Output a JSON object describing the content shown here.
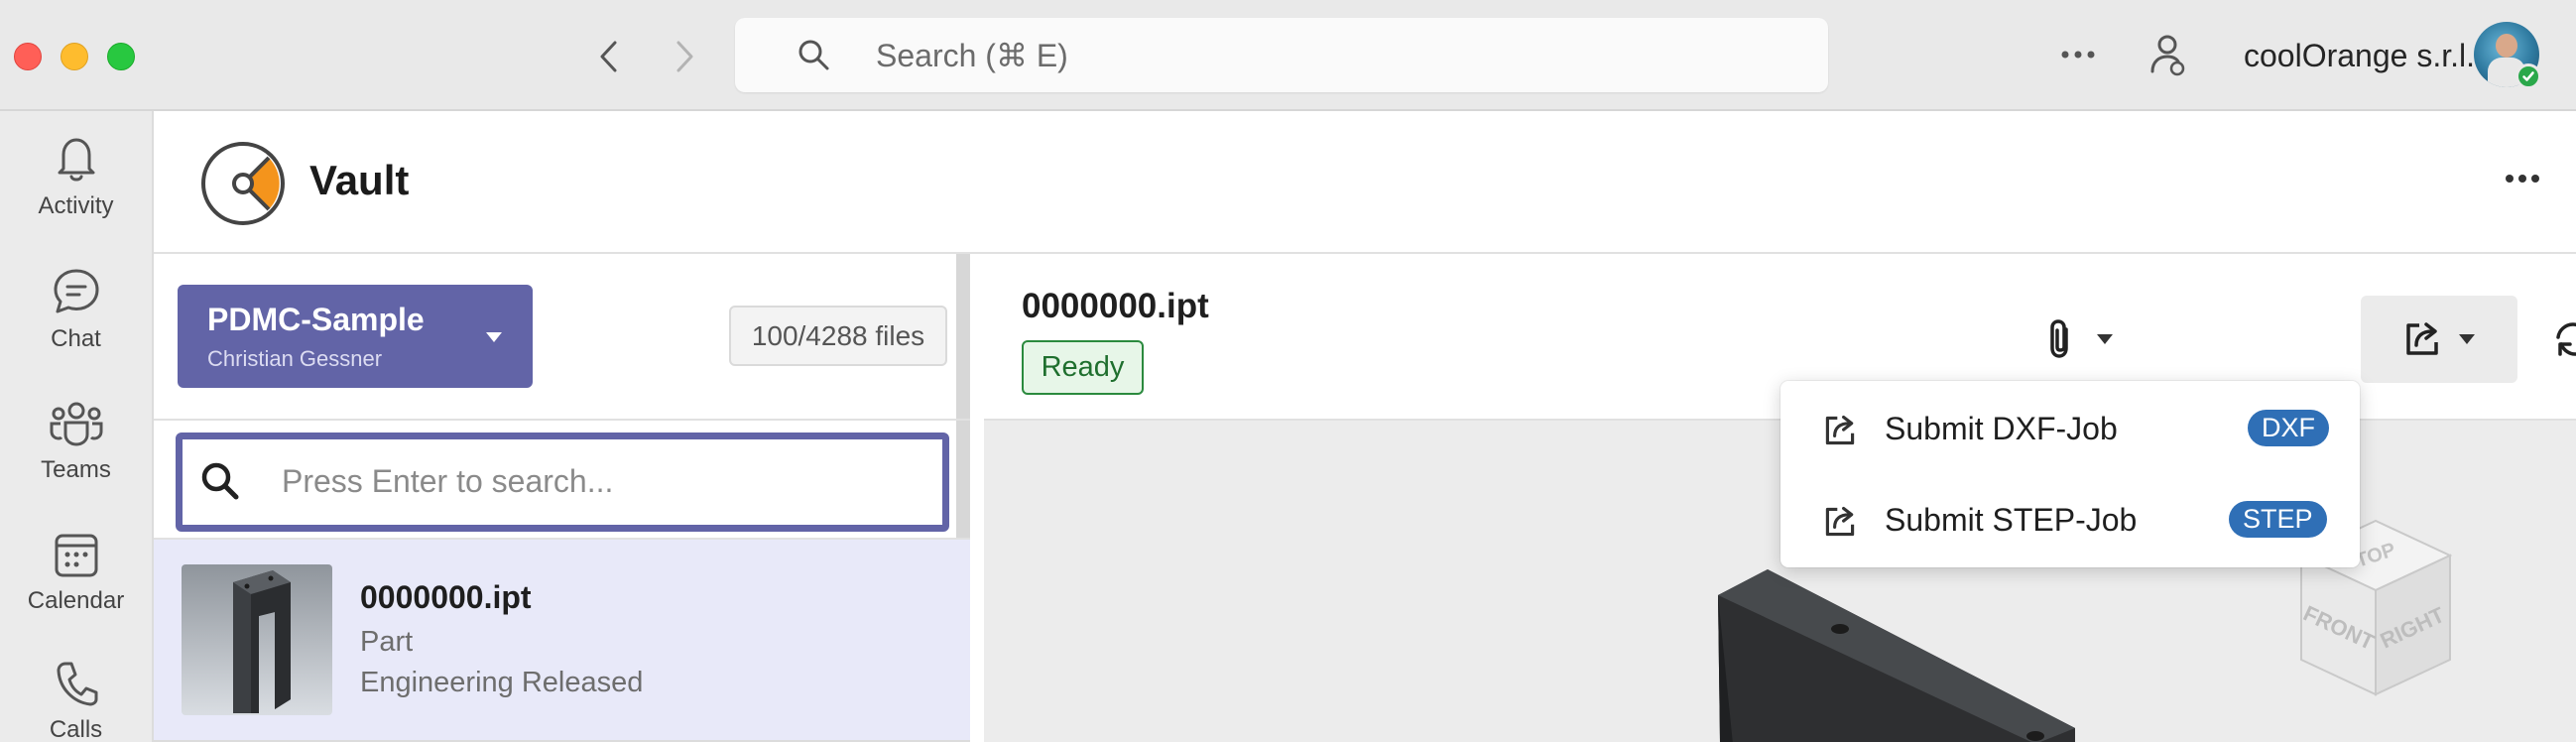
{
  "titlebar": {
    "search_placeholder": "Search (⌘ E)",
    "org_name": "coolOrange s.r.l.",
    "icons": [
      "chevron-left-icon",
      "chevron-right-icon",
      "search-icon",
      "more-icon",
      "person-icon"
    ]
  },
  "rail": {
    "items": [
      {
        "label": "Activity",
        "icon": "bell-icon"
      },
      {
        "label": "Chat",
        "icon": "chat-icon"
      },
      {
        "label": "Teams",
        "icon": "teams-icon"
      },
      {
        "label": "Calendar",
        "icon": "calendar-icon"
      },
      {
        "label": "Calls",
        "icon": "phone-icon"
      }
    ]
  },
  "app": {
    "title": "Vault",
    "accent": "#6264a7"
  },
  "left_panel": {
    "workspace": {
      "name": "PDMC-Sample",
      "user": "Christian Gessner"
    },
    "files_count": "100/4288 files",
    "search_placeholder": "Press Enter to search...",
    "files": [
      {
        "name": "0000000.ipt",
        "type": "Part",
        "state": "Engineering Released"
      }
    ]
  },
  "document": {
    "title": "0000000.ipt",
    "status": "Ready",
    "status_color": "#2b8a3e"
  },
  "export_menu": {
    "items": [
      {
        "label": "Submit DXF-Job",
        "badge": "DXF"
      },
      {
        "label": "Submit STEP-Job",
        "badge": "STEP"
      }
    ],
    "badge_color": "#2f6fb6"
  },
  "viewcube": {
    "top": "TOP",
    "front": "FRONT",
    "right": "RIGHT"
  }
}
